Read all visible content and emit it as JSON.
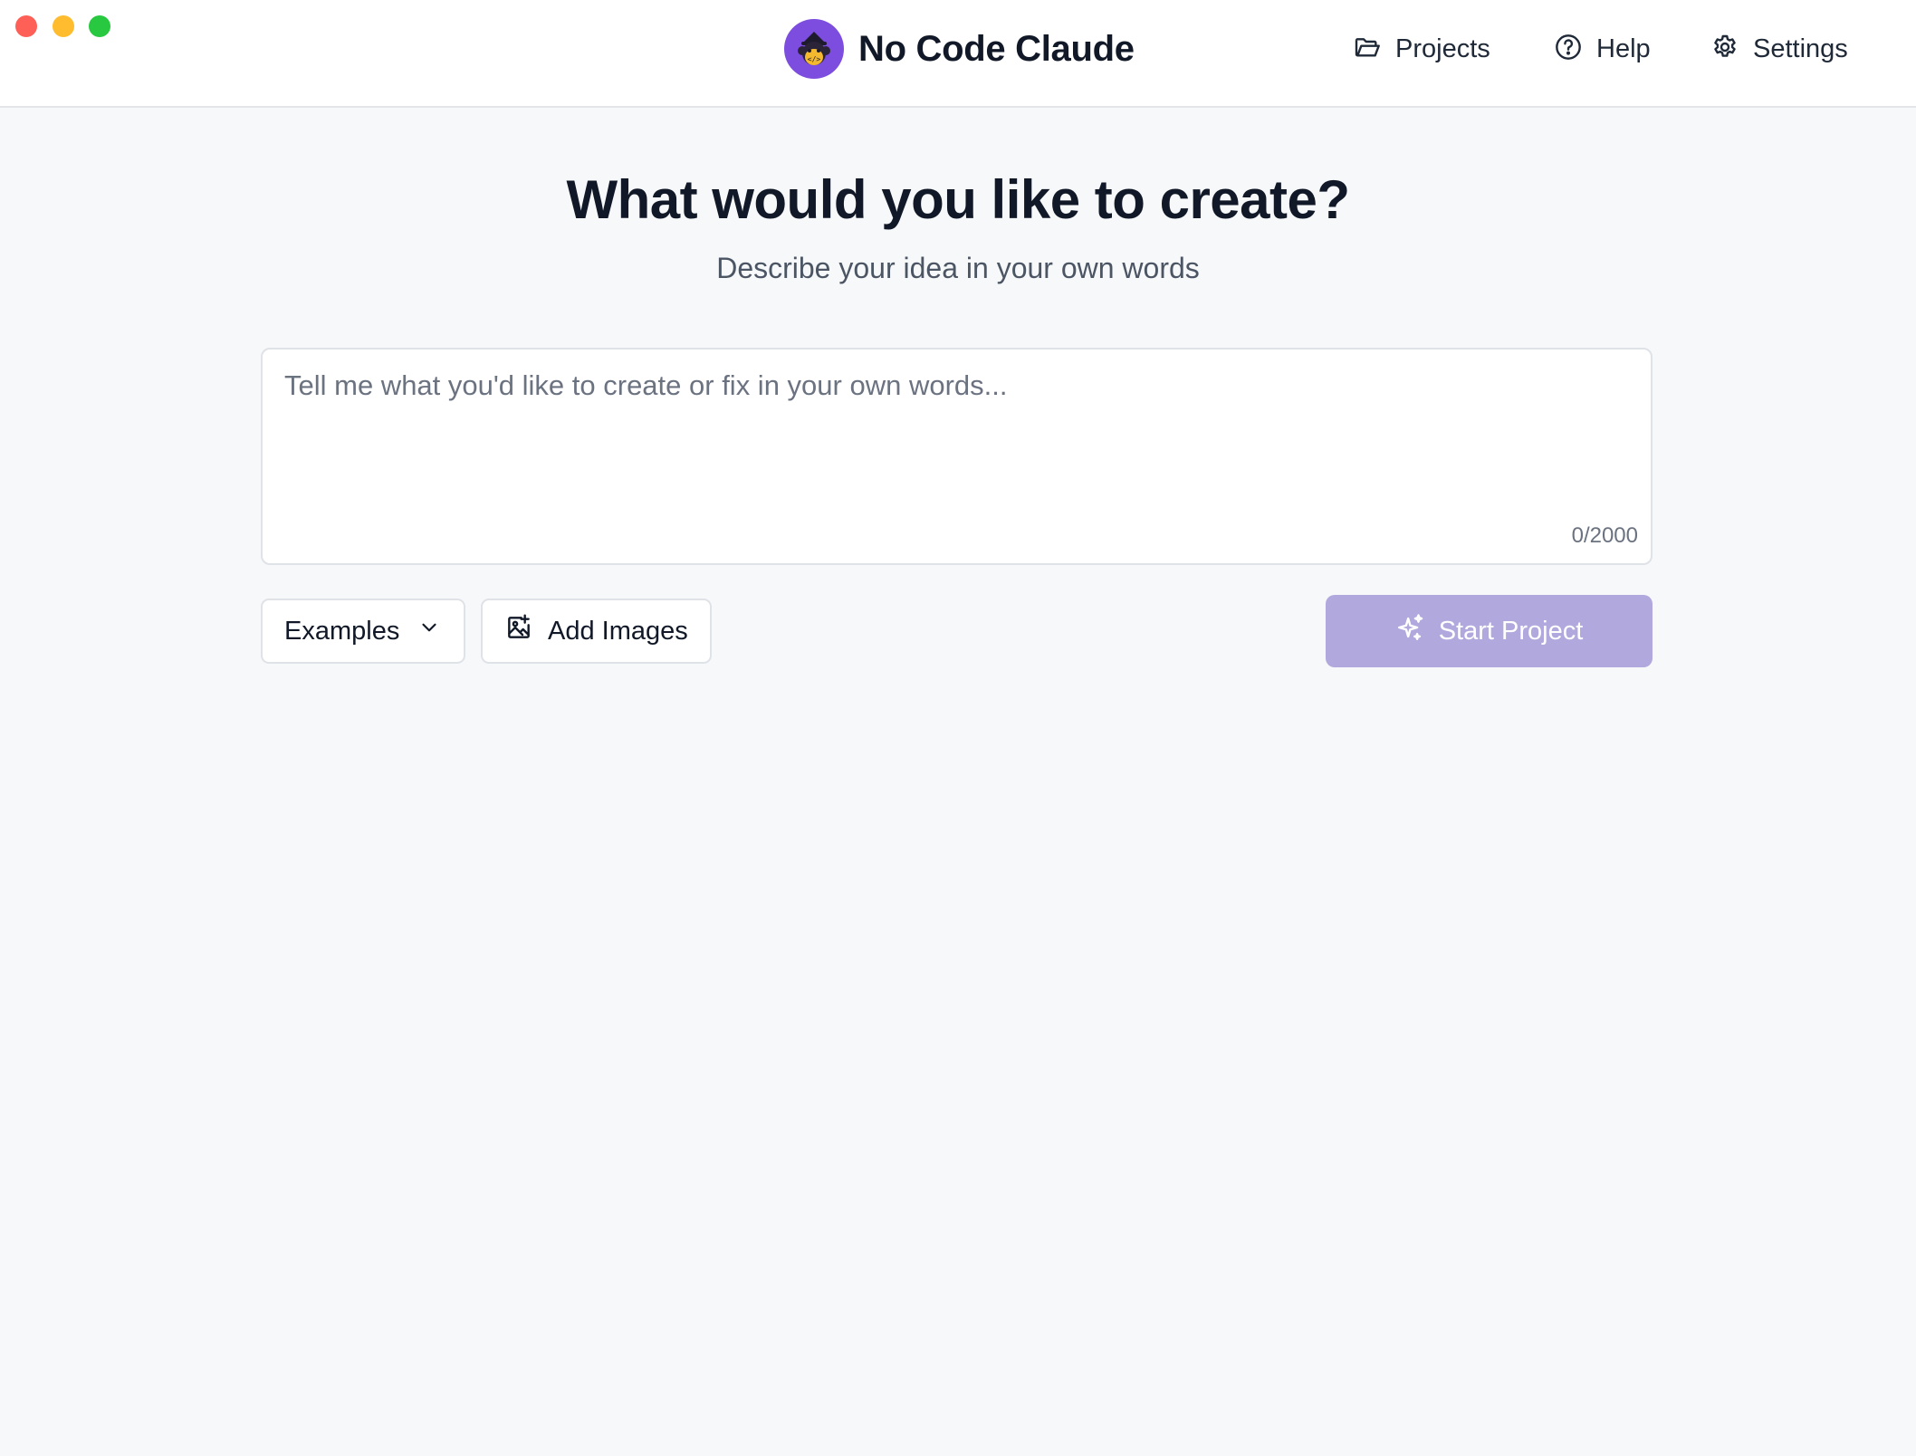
{
  "app": {
    "name": "No Code Claude",
    "logo_icon": "claude-monkey-logo-icon",
    "brand_color": "#7c4dde"
  },
  "window_controls": {
    "close_color": "#fe5f57",
    "minimize_color": "#febc2e",
    "maximize_color": "#28c840"
  },
  "nav": {
    "items": [
      {
        "label": "Projects",
        "icon": "folder-icon"
      },
      {
        "label": "Help",
        "icon": "help-circle-icon"
      },
      {
        "label": "Settings",
        "icon": "gear-icon"
      }
    ]
  },
  "main": {
    "heading": "What would you like to create?",
    "subheading": "Describe your idea in your own words",
    "prompt": {
      "value": "",
      "placeholder": "Tell me what you'd like to create or fix in your own words...",
      "counter": "0/2000"
    },
    "actions": {
      "examples_label": "Examples",
      "examples_icon": "chevron-down-icon",
      "add_images_label": "Add Images",
      "add_images_icon": "image-plus-icon",
      "start_label": "Start Project",
      "start_icon": "sparkles-icon",
      "start_color": "#b1a8de"
    }
  }
}
